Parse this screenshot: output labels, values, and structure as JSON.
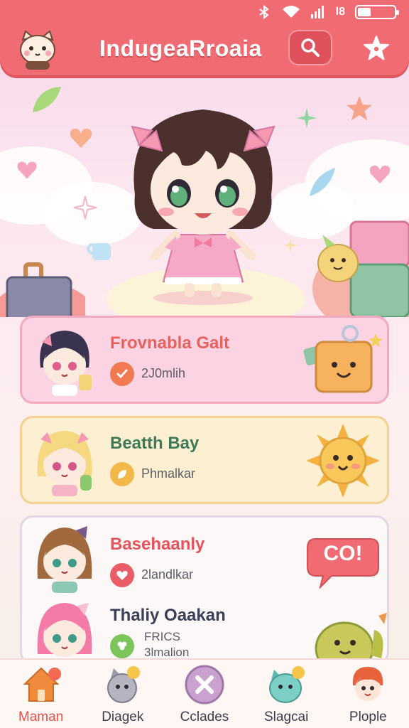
{
  "status_bar": {
    "indicators": [
      "bluetooth-icon",
      "wifi-icon",
      "signal-icon"
    ],
    "carrier_text": "l8",
    "battery_level": 0.35
  },
  "header": {
    "title": "IndugeaRroaia",
    "search_icon": "search-icon",
    "star_icon": "star-icon",
    "logo_icon": "cat-face-icon"
  },
  "cards": [
    {
      "title": "Frovnabla Galt",
      "subtitle": "2J0mlih",
      "title_color": "#e8625d",
      "badge_icon": "check-icon",
      "badge_color": "#f27a52",
      "deco_icon": "gift-box-icon"
    },
    {
      "title": "Beatth Bay",
      "subtitle": "Phmalkar",
      "title_color": "#3e7a5a",
      "badge_icon": "leaf-icon",
      "badge_color": "#f2b84a",
      "deco_icon": "sun-icon"
    },
    {
      "title": "Basehaanly",
      "subtitle": "2landlkar",
      "title_color": "#e8525c",
      "badge_icon": "heart-check-icon",
      "badge_color": "#ea5d66",
      "deco_icon": "speech-bubble-icon",
      "deco_text": "CO!"
    },
    {
      "title": "Thaliy Oaakan",
      "subtitle_line1": "FRICS",
      "subtitle_line2": "3lmalion",
      "title_color": "#3a3f5a",
      "badge_icon": "clover-icon",
      "badge_color": "#7cc45c",
      "deco_icon": "pear-creature-icon"
    }
  ],
  "nav": [
    {
      "label": "Maman",
      "icon": "house-icon",
      "active": true
    },
    {
      "label": "Diagek",
      "icon": "cat-icon",
      "active": false
    },
    {
      "label": "Cclades",
      "icon": "close-circle-icon",
      "active": false
    },
    {
      "label": "Slagcai",
      "icon": "monster-icon",
      "active": false
    },
    {
      "label": "Plople",
      "icon": "people-icon",
      "active": false
    }
  ],
  "colors": {
    "header_bg": "#f06b72",
    "accent": "#e8524c"
  }
}
